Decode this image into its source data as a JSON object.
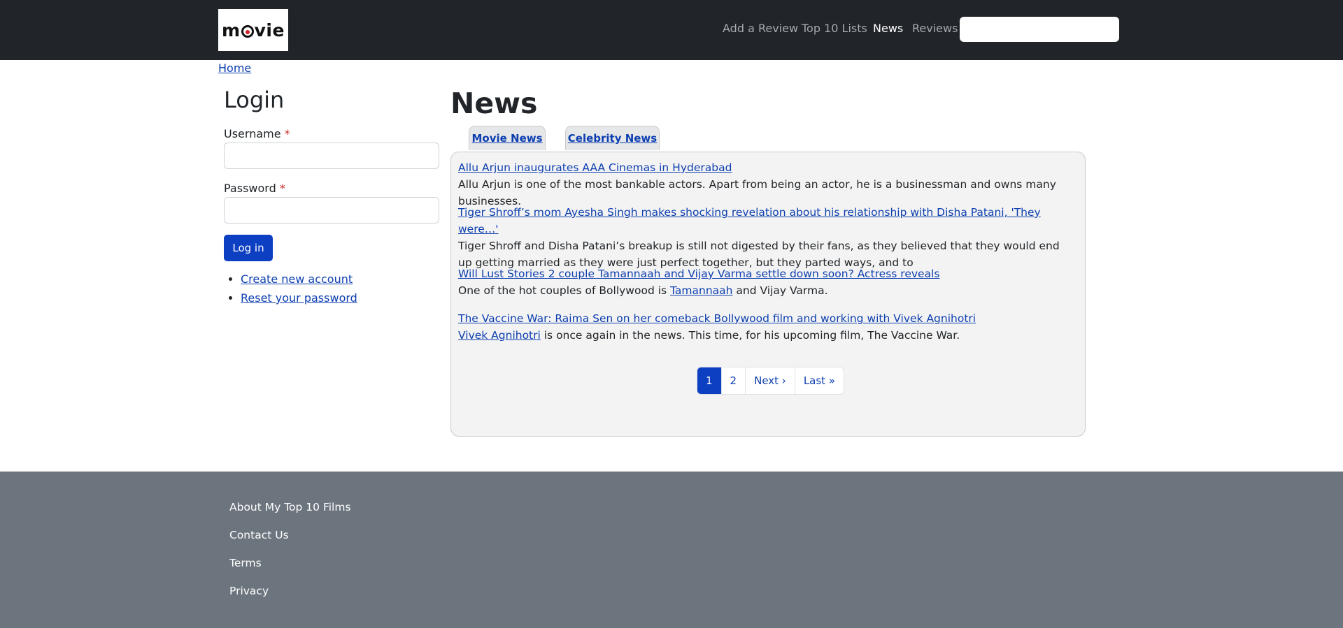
{
  "header": {
    "logo_text_pre": "m",
    "logo_text_post": "vie",
    "nav": [
      {
        "label": "Add a Review",
        "active": false
      },
      {
        "label": "Top 10 Lists",
        "active": false
      },
      {
        "label": "News",
        "active": true
      },
      {
        "label": "Reviews",
        "active": false
      }
    ],
    "search": {
      "placeholder": "",
      "value": ""
    }
  },
  "breadcrumb": {
    "home": "Home"
  },
  "login": {
    "title": "Login",
    "username_label": "Username",
    "password_label": "Password",
    "required_mark": "*",
    "button": "Log in",
    "links": [
      "Create new account",
      "Reset your password"
    ]
  },
  "news": {
    "title": "News",
    "tabs": [
      "Movie News",
      "Celebrity News"
    ],
    "articles": [
      {
        "headline": "Allu Arjun inaugurates AAA Cinemas in Hyderabad",
        "summary": "Allu Arjun is one of the most bankable actors. Apart from being an actor, he is a businessman and owns many businesses."
      },
      {
        "headline": "Tiger Shroff’s mom Ayesha Singh makes shocking revelation about his relationship with Disha Patani, 'They were…'",
        "summary": "Tiger Shroff and Disha Patani’s breakup is still not digested by their fans, as they believed that they would end up getting married as they were just perfect together, but they parted ways, and to"
      },
      {
        "headline": "Will Lust Stories 2 couple Tamannaah and Vijay Varma settle down soon? Actress reveals",
        "summary_pre": "One of the hot couples of Bollywood is ",
        "summary_link": "Tamannaah",
        "summary_post": " and Vijay Varma."
      },
      {
        "headline": "The Vaccine War: Raima Sen on her comeback Bollywood film and working with Vivek Agnihotri",
        "summary_link": "Vivek Agnihotri",
        "summary_post": " is once again in the news. This time, for his upcoming film, The Vaccine War."
      }
    ],
    "pager": {
      "pages": [
        "1",
        "2"
      ],
      "current": "1",
      "next": "Next ›",
      "last": "Last »"
    }
  },
  "footer": {
    "links": [
      "About My Top 10 Films",
      "Contact Us",
      "Terms",
      "Privacy"
    ]
  },
  "colors": {
    "navbar": "#212529",
    "accent": "#0d3fc3",
    "footer": "#6c757d"
  }
}
